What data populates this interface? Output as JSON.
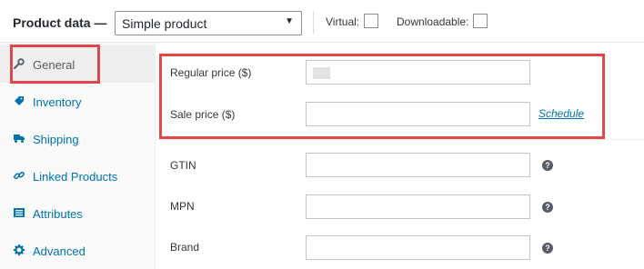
{
  "header": {
    "title": "Product data —",
    "product_type": "Simple product",
    "virtual_label": "Virtual:",
    "downloadable_label": "Downloadable:"
  },
  "sidebar": {
    "items": [
      {
        "label": "General",
        "icon": "wrench-icon",
        "active": true
      },
      {
        "label": "Inventory",
        "icon": "tag-icon",
        "active": false
      },
      {
        "label": "Shipping",
        "icon": "truck-icon",
        "active": false
      },
      {
        "label": "Linked Products",
        "icon": "link-icon",
        "active": false
      },
      {
        "label": "Attributes",
        "icon": "list-icon",
        "active": false
      },
      {
        "label": "Advanced",
        "icon": "gear-icon",
        "active": false
      }
    ]
  },
  "fields": {
    "regular_price_label": "Regular price ($)",
    "sale_price_label": "Sale price ($)",
    "schedule_link": "Schedule",
    "gtin_label": "GTIN",
    "mpn_label": "MPN",
    "brand_label": "Brand",
    "help_glyph": "?"
  },
  "colors": {
    "link": "#0073aa",
    "highlight_border": "#e04848",
    "help_icon": "#555d66"
  }
}
